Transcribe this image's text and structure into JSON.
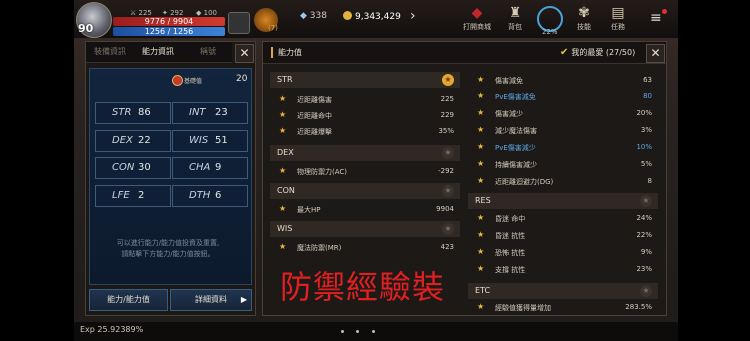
{
  "hud": {
    "level": "90",
    "stat_a": "225",
    "stat_b": "292",
    "stat_c": "100",
    "hp": "9776 / 9904",
    "mp": "1256 / 1256",
    "pet_count": "(7)",
    "gem_count": "338",
    "gold": "9,343,429",
    "menu": [
      {
        "label": "打開商城",
        "icon": "shop-icon"
      },
      {
        "label": "背包",
        "icon": "bag-icon"
      },
      {
        "label": "技能",
        "icon": "skill-icon"
      },
      {
        "label": "任務",
        "icon": "quest-icon"
      }
    ],
    "clock_value": "22%"
  },
  "left_panel": {
    "tabs": [
      "裝備資訊",
      "能力資訊",
      "稱號"
    ],
    "bonus_label": "基礎值",
    "bonus_value": "20",
    "stats": [
      {
        "name": "STR",
        "value": "86"
      },
      {
        "name": "INT",
        "value": "23"
      },
      {
        "name": "DEX",
        "value": "22"
      },
      {
        "name": "WIS",
        "value": "51"
      },
      {
        "name": "CON",
        "value": "30"
      },
      {
        "name": "CHA",
        "value": "9"
      },
      {
        "name": "LFE",
        "value": "2"
      },
      {
        "name": "DTH",
        "value": "6"
      }
    ],
    "note_line1": "可以進行能力/能力值投資及重置,",
    "note_line2": "請點擊下方能力/能力值按鈕。",
    "btn_ability": "能力/能力值",
    "btn_detail": "詳細資料"
  },
  "right_panel": {
    "title": "能力值",
    "favorite": "我的最愛 (27/50)",
    "left_col": [
      {
        "section": "STR",
        "starred": true,
        "rows": [
          {
            "label": "近距離傷害",
            "value": "225"
          },
          {
            "label": "近距離命中",
            "value": "229"
          },
          {
            "label": "近距離爆擊",
            "value": "35%"
          }
        ]
      },
      {
        "section": "DEX",
        "starred": false,
        "rows": [
          {
            "label": "物理防禦力(AC)",
            "value": "-292"
          }
        ]
      },
      {
        "section": "CON",
        "starred": false,
        "rows": [
          {
            "label": "最大HP",
            "value": "9904"
          }
        ]
      },
      {
        "section": "WIS",
        "starred": false,
        "rows": [
          {
            "label": "魔法防禦(MR)",
            "value": "423"
          }
        ]
      }
    ],
    "right_col_top": [
      {
        "label": "傷害減免",
        "value": "63",
        "blue": false
      },
      {
        "label": "PvE傷害減免",
        "value": "80",
        "blue": true
      },
      {
        "label": "傷害減少",
        "value": "20%",
        "blue": false
      },
      {
        "label": "減少魔法傷害",
        "value": "3%",
        "blue": false
      },
      {
        "label": "PvE傷害減少",
        "value": "10%",
        "blue": true
      },
      {
        "label": "持續傷害減少",
        "value": "5%",
        "blue": false
      },
      {
        "label": "近距離迴避力(DG)",
        "value": "8",
        "blue": false
      }
    ],
    "res_section": "RES",
    "res_rows": [
      {
        "label": "昏迷 命中",
        "value": "24%"
      },
      {
        "label": "昏迷 抗性",
        "value": "22%"
      },
      {
        "label": "恐怖 抗性",
        "value": "9%"
      },
      {
        "label": "支撐 抗性",
        "value": "23%"
      }
    ],
    "etc_section": "ETC",
    "etc_rows": [
      {
        "label": "經驗值獲得量增加",
        "value": "283.5%"
      }
    ]
  },
  "overlay_text": "防禦經驗裝",
  "exp_text": "Exp 25.92389%"
}
